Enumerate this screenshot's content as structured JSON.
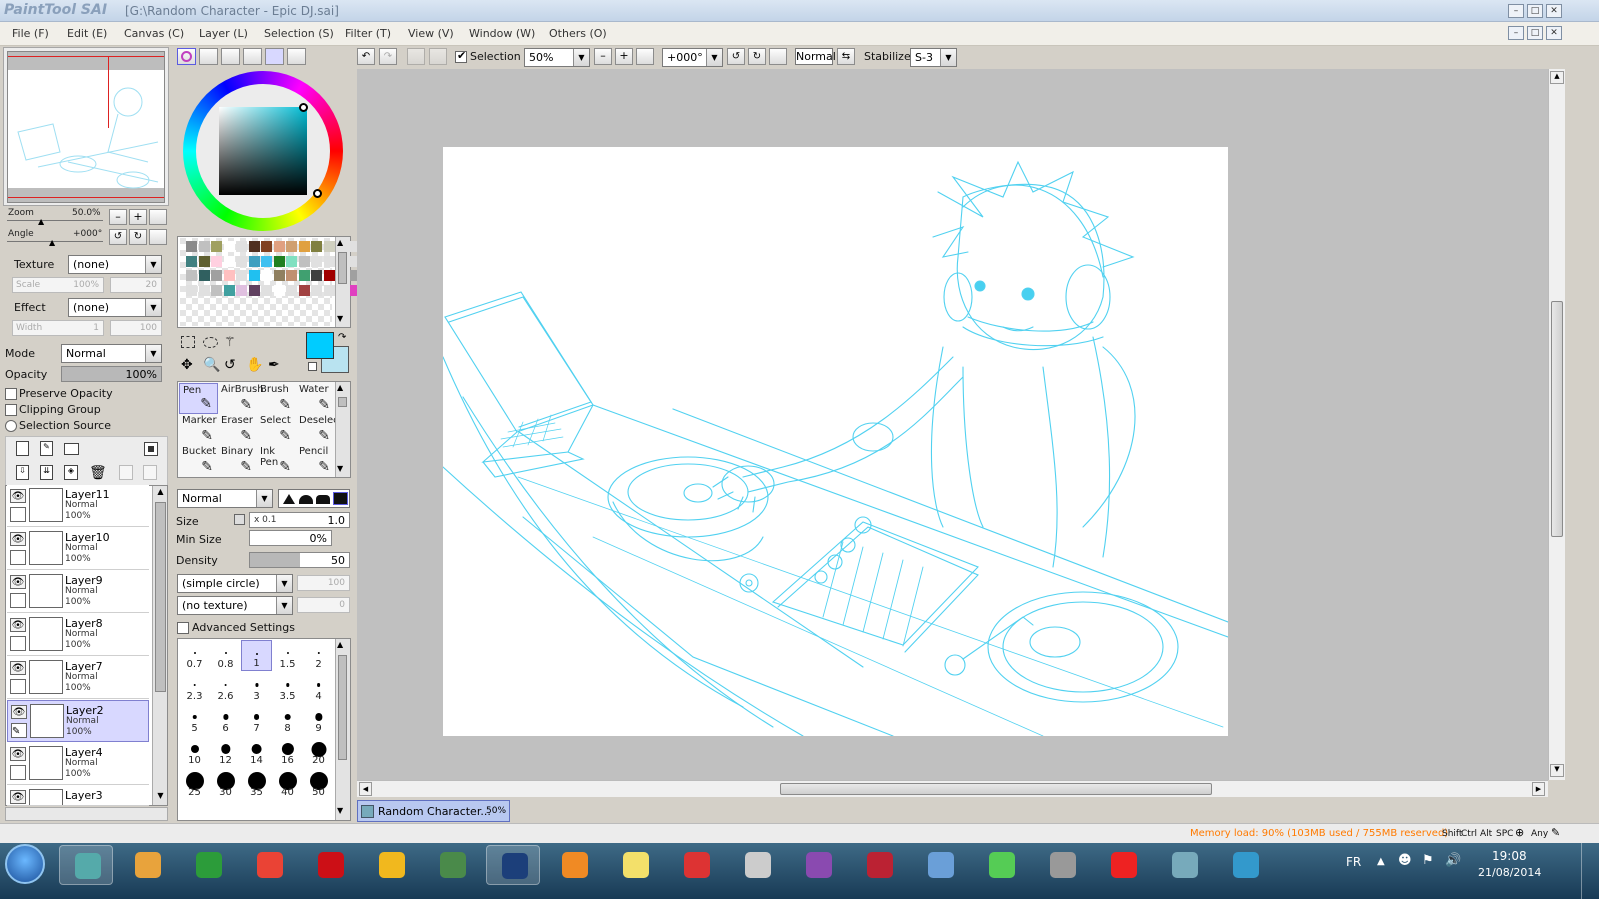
{
  "window": {
    "app_name": "PaintTool SAI",
    "title": "[G:\\Random Character - Epic DJ.sai]"
  },
  "menubar": [
    {
      "label": "File (F)"
    },
    {
      "label": "Edit (E)"
    },
    {
      "label": "Canvas (C)"
    },
    {
      "label": "Layer (L)"
    },
    {
      "label": "Selection (S)"
    },
    {
      "label": "Filter (T)"
    },
    {
      "label": "View (V)"
    },
    {
      "label": "Window (W)"
    },
    {
      "label": "Others (O)"
    }
  ],
  "toolbar": {
    "selection_label": "Selection",
    "selection_checked": true,
    "zoom": "50%",
    "angle": "+000°",
    "blend": "Normal",
    "stabilizer_label": "Stabilizer",
    "stabilizer_value": "S-3"
  },
  "navigator": {
    "zoom_label": "Zoom",
    "zoom_value": "50.0%",
    "angle_label": "Angle",
    "angle_value": "+000°"
  },
  "layer_props": {
    "texture_label": "Texture",
    "texture_value": "(none)",
    "scale_label": "Scale",
    "scale_value": "100%",
    "scale_num": "20",
    "effect_label": "Effect",
    "effect_value": "(none)",
    "width_label": "Width",
    "width_value": "1",
    "width_num": "100",
    "mode_label": "Mode",
    "mode_value": "Normal",
    "opacity_label": "Opacity",
    "opacity_value": "100%",
    "opacity_fraction": 1.0,
    "preserve_opacity": "Preserve Opacity",
    "clipping_group": "Clipping Group",
    "selection_source": "Selection Source"
  },
  "layers": [
    {
      "name": "Layer11",
      "mode": "Normal",
      "opacity": "100%",
      "selected": false
    },
    {
      "name": "Layer10",
      "mode": "Normal",
      "opacity": "100%",
      "selected": false
    },
    {
      "name": "Layer9",
      "mode": "Normal",
      "opacity": "100%",
      "selected": false
    },
    {
      "name": "Layer8",
      "mode": "Normal",
      "opacity": "100%",
      "selected": false
    },
    {
      "name": "Layer7",
      "mode": "Normal",
      "opacity": "100%",
      "selected": false
    },
    {
      "name": "Layer2",
      "mode": "Normal",
      "opacity": "100%",
      "selected": true
    },
    {
      "name": "Layer4",
      "mode": "Normal",
      "opacity": "100%",
      "selected": false
    },
    {
      "name": "Layer3",
      "mode": "",
      "opacity": "",
      "selected": false
    }
  ],
  "colors": {
    "foreground": "#00ccff",
    "background": "#b9e3f0",
    "hue_ring_accent": "#00bcd4",
    "sketch_stroke": "#29c8ee"
  },
  "swatches": [
    "#8a8a8a",
    "#c0c0c0",
    "#a0a060",
    "#ffffff",
    "#e0e0e0",
    "#503020",
    "#804020",
    "#e0a080",
    "#d0a070",
    "#e0a040",
    "#808040",
    "#d0d0c0",
    "#a0a0a0",
    "#e0e0e0",
    "#f0d0b0",
    "#80c0e0",
    "#3060ff",
    "#408080",
    "#606030",
    "#ffd0e0",
    "#ffffff",
    "#e0e0e0",
    "#40a0c0",
    "#40c0f0",
    "#208020",
    "#80e0c0",
    "#c0c0c0",
    "#e0e0e0",
    "#e0e0e0",
    "#ffffff",
    "#e0e0e0",
    "#e0e0e0",
    "#503020",
    "#e0e0e0",
    "#c0c0c0",
    "#306060",
    "#a0a0a0",
    "#ffc0c0",
    "#e0e0e0",
    "#20c0f0",
    "#ffffff",
    "#908060",
    "#c09070",
    "#40a070",
    "#404040",
    "#a00000",
    "#e0e0e0",
    "#a0a0a0",
    "#e0e0e0",
    "#303030",
    "#f0f0f0",
    "#e0e0e0",
    "#e0e0e0",
    "#c0c0c0",
    "#40a0a0",
    "#e0c0e0",
    "#604060",
    "#e0e0e0",
    "#ffffff",
    "#e0e0e0",
    "#a04040",
    "#e0e0e0",
    "#e0e0e0",
    "#a020c0",
    "#e040c0",
    "#e0e0e0",
    "#e0e0e0",
    "#404040"
  ],
  "tools": [
    {
      "name": "Pen",
      "selected": true
    },
    {
      "name": "AirBrush",
      "selected": false
    },
    {
      "name": "Brush",
      "selected": false
    },
    {
      "name": "Water",
      "selected": false
    },
    {
      "name": "Marker",
      "selected": false
    },
    {
      "name": "Eraser",
      "selected": false
    },
    {
      "name": "Select",
      "selected": false
    },
    {
      "name": "Deselect",
      "selected": false
    },
    {
      "name": "Bucket",
      "selected": false
    },
    {
      "name": "Binary",
      "selected": false
    },
    {
      "name": "Ink Pen",
      "selected": false
    },
    {
      "name": "Pencil",
      "selected": false
    }
  ],
  "brush": {
    "blend_mode": "Normal",
    "size_label": "Size",
    "size_mult": "x 0.1",
    "size_value": "1.0",
    "min_size_label": "Min Size",
    "min_size_value": "0%",
    "density_label": "Density",
    "density_value": "50",
    "density_fraction": 0.5,
    "shape": "(simple circle)",
    "shape_value": "100",
    "texture": "(no texture)",
    "texture_value": "0",
    "advanced_label": "Advanced Settings"
  },
  "brush_sizes": [
    "0.7",
    "0.8",
    "1",
    "1.5",
    "2",
    "2.3",
    "2.6",
    "3",
    "3.5",
    "4",
    "5",
    "6",
    "7",
    "8",
    "9",
    "10",
    "12",
    "14",
    "16",
    "20",
    "25",
    "30",
    "35",
    "40",
    "50"
  ],
  "brush_size_selected": "1",
  "document_tab": {
    "name": "Random Character...",
    "zoom": "50%"
  },
  "statusbar": {
    "memory": "Memory load: 90% (103MB used / 755MB reserved)",
    "keys": [
      "Shift",
      "Ctrl",
      "Alt",
      "SPC",
      "Any"
    ]
  },
  "taskbar": {
    "lang": "FR",
    "time": "19:08",
    "date": "21/08/2014",
    "apps": [
      "windows-start",
      "paint-tool-sai",
      "file-explorer",
      "media-player",
      "chrome",
      "opera",
      "chrome-canary",
      "game",
      "photoshop",
      "vlc",
      "sticky-notes",
      "recorder",
      "scanner",
      "winrar",
      "filezilla",
      "control-panel",
      "color-app",
      "wall-app",
      "dual-loop",
      "users-app",
      "miku-app"
    ]
  }
}
